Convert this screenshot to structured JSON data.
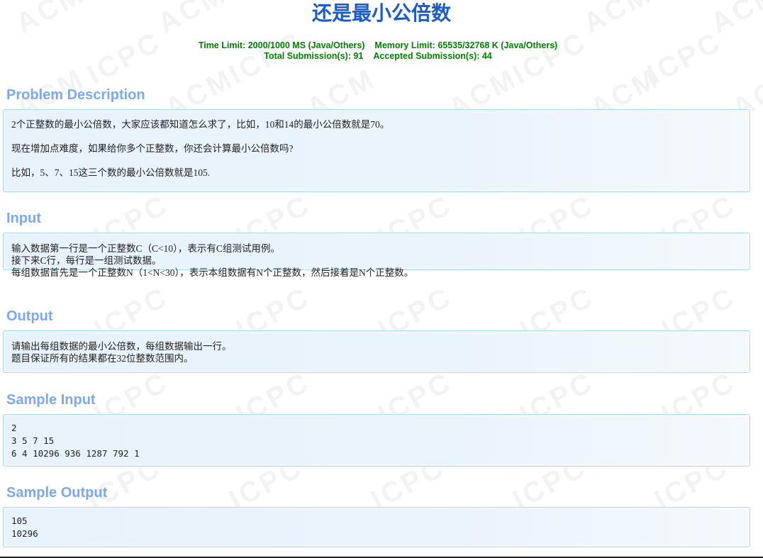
{
  "title": "还是最小公倍数",
  "limits": {
    "time_limit": "Time Limit: 2000/1000 MS (Java/Others)",
    "memory_limit": "Memory Limit: 65535/32768 K (Java/Others)",
    "total_submissions": "Total Submission(s): 91",
    "accepted_submissions": "Accepted Submission(s): 44"
  },
  "watermark": {
    "acm": "ACM",
    "icpc": "ICPC"
  },
  "sections": {
    "description": {
      "heading": "Problem Description",
      "lines": [
        "2个正整数的最小公倍数，大家应该都知道怎么求了，比如，10和14的最小公倍数就是70。",
        "现在增加点难度，如果给你多个正整数，你还会计算最小公倍数吗?",
        "比如，5、7、15这三个数的最小公倍数就是105."
      ]
    },
    "input": {
      "heading": "Input",
      "lines": [
        "输入数据第一行是一个正整数C（C<10），表示有C组测试用例。",
        "接下来C行，每行是一组测试数据。",
        "每组数据首先是一个正整数N（1<N<30），表示本组数据有N个正整数，然后接着是N个正整数。"
      ]
    },
    "output": {
      "heading": "Output",
      "lines": [
        "请输出每组数据的最小公倍数，每组数据输出一行。",
        "题目保证所有的结果都在32位整数范围内。"
      ]
    },
    "sample_input": {
      "heading": "Sample Input",
      "lines": [
        "2",
        "3 5 7 15",
        "6 4 10296 936 1287 792 1"
      ]
    },
    "sample_output": {
      "heading": "Sample Output",
      "lines": [
        "105",
        "10296"
      ]
    }
  },
  "colors": {
    "title": "#1a5cc8",
    "limits": "#008000",
    "section_heading": "#7ca9ed",
    "panel_border": "#a9d6f5",
    "panel_background": "#e7f2fb"
  }
}
